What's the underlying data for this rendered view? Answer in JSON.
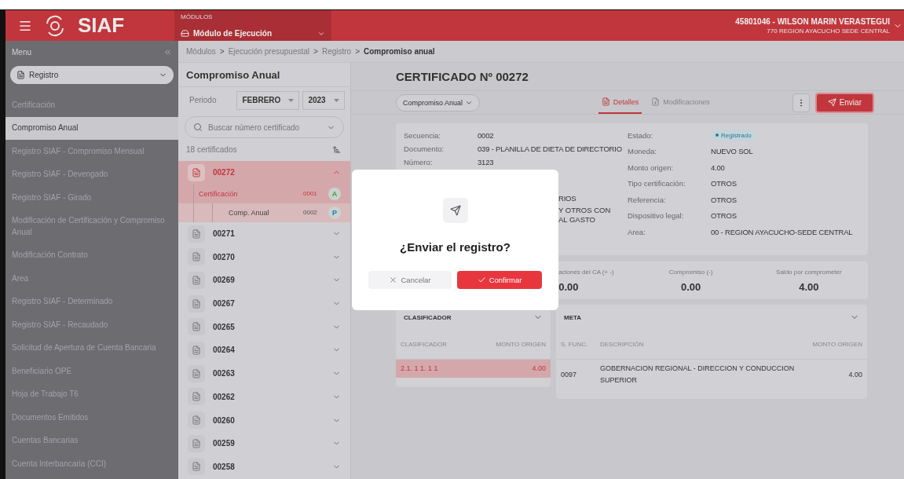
{
  "header": {
    "logo": "SIAF",
    "module_label": "MÓDULOS",
    "module": "Módulo de Ejecución",
    "user": "45801046 - WILSON MARIN VERASTEGUI",
    "org": "770  REGION AYACUCHO SEDE CENTRAL"
  },
  "sidebar": {
    "title": "Menu",
    "group": "Registro",
    "items": [
      {
        "label": "Certificación",
        "selected": false
      },
      {
        "label": "Compromiso Anual",
        "selected": true
      },
      {
        "label": "Registro SIAF - Compromiso Mensual",
        "selected": false
      },
      {
        "label": "Registro SIAF - Devengado",
        "selected": false
      },
      {
        "label": "Registro SIAF - Girado",
        "selected": false
      },
      {
        "label": "Modificación de Certificación y Compromiso Anual",
        "selected": false
      },
      {
        "label": "Modificación Contrato",
        "selected": false
      },
      {
        "label": "Area",
        "selected": false
      },
      {
        "label": "Registro SIAF - Determinado",
        "selected": false
      },
      {
        "label": "Registro SIAF - Recaudado",
        "selected": false
      },
      {
        "label": "Solicitud de Apertura de Cuenta Bancaria",
        "selected": false
      },
      {
        "label": "Beneficiario OPE",
        "selected": false
      },
      {
        "label": "Hoja de Trabajo T6",
        "selected": false
      },
      {
        "label": "Documentos Emitidos",
        "selected": false
      },
      {
        "label": "Cuentas Bancarias",
        "selected": false
      },
      {
        "label": "Cuenta Interbancaria (CCI)",
        "selected": false
      }
    ]
  },
  "breadcrumbs": [
    "Módulos",
    "Ejecución presupuestal",
    "Registro",
    "Compromiso anual"
  ],
  "breadcrumb_separator": ">",
  "list_panel": {
    "title": "Compromiso Anual",
    "period_label": "Periodo",
    "month": "FEBRERO",
    "year": "2023",
    "search": {
      "placeholder": "Buscar número certificado"
    },
    "count": "18 certificados",
    "certificates": [
      {
        "number": "00272",
        "selected": true,
        "expanded": true,
        "children": [
          {
            "label": "Certificación",
            "code": "0001",
            "badge": "A",
            "color": "#4f9a45",
            "selected": true,
            "children": [
              {
                "label": "Comp. Anual",
                "code": "0002",
                "badge": "P",
                "color": "#2a74b5",
                "selected": false
              }
            ]
          }
        ]
      },
      {
        "number": "00271",
        "selected": false,
        "expanded": false
      },
      {
        "number": "00270",
        "selected": false,
        "expanded": false
      },
      {
        "number": "00269",
        "selected": false,
        "expanded": false
      },
      {
        "number": "00267",
        "selected": false,
        "expanded": false
      },
      {
        "number": "00265",
        "selected": false,
        "expanded": false
      },
      {
        "number": "00264",
        "selected": false,
        "expanded": false
      },
      {
        "number": "00263",
        "selected": false,
        "expanded": false
      },
      {
        "number": "00262",
        "selected": false,
        "expanded": false
      },
      {
        "number": "00260",
        "selected": false,
        "expanded": false
      },
      {
        "number": "00259",
        "selected": false,
        "expanded": false
      },
      {
        "number": "00258",
        "selected": false,
        "expanded": false
      }
    ]
  },
  "main": {
    "title": "CERTIFICADO Nº 00272",
    "type_select": "Compromiso Anual",
    "tabs": [
      {
        "label": "Detalles",
        "selected": true
      },
      {
        "label": "Modificaciones",
        "selected": false
      }
    ],
    "send_button": "Enviar",
    "details_left": [
      {
        "label": "Secuencia:",
        "value": "0002"
      },
      {
        "label": "Documento:",
        "value": "039 - PLANILLA DE DIETA DE DIRECTORIO"
      },
      {
        "label": "Número:",
        "value": "3123"
      },
      {
        "kind": "partial",
        "value": "RIOS"
      },
      {
        "kind": "partial",
        "value": "Y OTROS CON AL GASTO"
      }
    ],
    "details_right": [
      {
        "label": "Estado:",
        "value": "Registrado",
        "kind": "status"
      },
      {
        "label": "Moneda:",
        "value": "NUEVO SOL"
      },
      {
        "label": "Monto origen:",
        "value": "4.00"
      },
      {
        "label": "Tipo certificación:",
        "value": "OTROS"
      },
      {
        "label": "Referencia:",
        "value": "OTROS"
      },
      {
        "label": "Dispositivo legal:",
        "value": "OTROS"
      },
      {
        "label": "Area:",
        "value": "00 - REGION AYACUCHO-SEDE CENTRAL"
      }
    ],
    "summary": [
      {
        "kind": "partial",
        "label": "aciones del CA (+ -)",
        "value": "0.00"
      },
      {
        "label": "Compromiso (-)",
        "value": "0.00"
      },
      {
        "label": "Saldo por comprometer",
        "value": "4.00"
      }
    ],
    "clasificador": {
      "title": "CLASIFICADOR",
      "columns": [
        "CLASIFICADOR",
        "MONTO ORIGEN"
      ],
      "rows": [
        {
          "cells": [
            "2.1. 1 1. 1 1",
            "4.00"
          ],
          "selected": true
        }
      ]
    },
    "meta": {
      "title": "META",
      "columns": [
        "S. FUNC.",
        "DESCRIPCIÓN",
        "MONTO ORIGEN"
      ],
      "rows": [
        {
          "cells": [
            "0097",
            "GOBERNACION REGIONAL - DIRECCION Y CONDUCCION SUPERIOR",
            "4.00"
          ],
          "selected": false
        }
      ]
    }
  },
  "dialog": {
    "title": "¿Enviar el registro?",
    "buttons": [
      {
        "label": "Cancelar",
        "kind": "secondary"
      },
      {
        "label": "Confirmar",
        "kind": "primary"
      }
    ]
  }
}
